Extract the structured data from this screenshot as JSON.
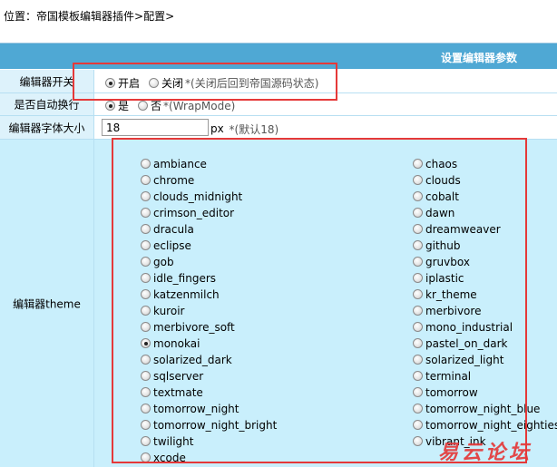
{
  "breadcrumb": {
    "prefix": "位置：",
    "link1": "帝国模板编辑器插件",
    "sep": ">",
    "link2": "配置",
    "end": ">"
  },
  "header": {
    "title": "设置编辑器参数"
  },
  "editor_switch": {
    "label": "编辑器开关",
    "on_label": "开启",
    "off_label": "关闭",
    "hint": "*(关闭后回到帝国源码状态)",
    "selected": "on"
  },
  "auto_wrap": {
    "label": "是否自动换行",
    "yes_label": "是",
    "no_label": "否",
    "hint": "*(WrapMode)",
    "selected": "yes"
  },
  "font_size": {
    "label": "编辑器字体大小",
    "value": "18",
    "unit": "px",
    "hint": "*(默认18)"
  },
  "theme": {
    "label": "编辑器theme",
    "selected": "monokai",
    "left_column": [
      "ambiance",
      "chrome",
      "clouds_midnight",
      "crimson_editor",
      "dracula",
      "eclipse",
      "gob",
      "idle_fingers",
      "katzenmilch",
      "kuroir",
      "merbivore_soft",
      "monokai",
      "solarized_dark",
      "sqlserver",
      "textmate",
      "tomorrow_night",
      "tomorrow_night_bright",
      "twilight",
      "xcode"
    ],
    "right_column": [
      "chaos",
      "clouds",
      "cobalt",
      "dawn",
      "dreamweaver",
      "github",
      "gruvbox",
      "iplastic",
      "kr_theme",
      "merbivore",
      "mono_industrial",
      "pastel_on_dark",
      "solarized_light",
      "terminal",
      "tomorrow",
      "tomorrow_night_blue",
      "tomorrow_night_eighties",
      "vibrant_ink"
    ]
  },
  "colors": {
    "header_bg": "#4fa8d4",
    "label_bg": "#ddf2fb",
    "theme_bg": "#c9effc",
    "annotation": "#e53939"
  },
  "watermark": "易云论坛"
}
